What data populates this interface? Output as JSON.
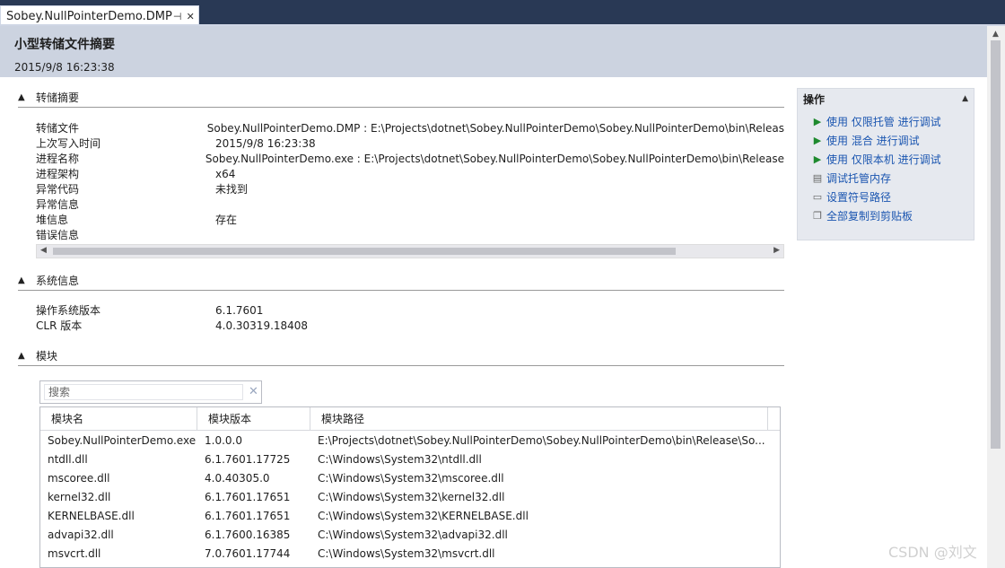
{
  "tab": {
    "title": "Sobey.NullPointerDemo.DMP",
    "pin_glyph": "⊣",
    "close_glyph": "✕"
  },
  "header": {
    "title": "小型转储文件摘要",
    "timestamp": "2015/9/8 16:23:38"
  },
  "sections": {
    "dump_summary": {
      "label": "转储摘要",
      "rows": [
        {
          "key": "转储文件",
          "value": "Sobey.NullPointerDemo.DMP : E:\\Projects\\dotnet\\Sobey.NullPointerDemo\\Sobey.NullPointerDemo\\bin\\Releas"
        },
        {
          "key": "上次写入时间",
          "value": "2015/9/8 16:23:38"
        },
        {
          "key": "进程名称",
          "value": "Sobey.NullPointerDemo.exe : E:\\Projects\\dotnet\\Sobey.NullPointerDemo\\Sobey.NullPointerDemo\\bin\\Release"
        },
        {
          "key": "进程架构",
          "value": "x64"
        },
        {
          "key": "异常代码",
          "value": "未找到"
        },
        {
          "key": "异常信息",
          "value": ""
        },
        {
          "key": "堆信息",
          "value": "存在"
        },
        {
          "key": "错误信息",
          "value": ""
        }
      ]
    },
    "system_info": {
      "label": "系统信息",
      "rows": [
        {
          "key": "操作系统版本",
          "value": "6.1.7601"
        },
        {
          "key": "CLR 版本",
          "value": "4.0.30319.18408"
        }
      ]
    },
    "modules": {
      "label": "模块",
      "search_placeholder": "搜索",
      "columns": [
        "模块名",
        "模块版本",
        "模块路径"
      ],
      "rows": [
        {
          "name": "Sobey.NullPointerDemo.exe",
          "version": "1.0.0.0",
          "path": "E:\\Projects\\dotnet\\Sobey.NullPointerDemo\\Sobey.NullPointerDemo\\bin\\Release\\So..."
        },
        {
          "name": "ntdll.dll",
          "version": "6.1.7601.17725",
          "path": "C:\\Windows\\System32\\ntdll.dll"
        },
        {
          "name": "mscoree.dll",
          "version": "4.0.40305.0",
          "path": "C:\\Windows\\System32\\mscoree.dll"
        },
        {
          "name": "kernel32.dll",
          "version": "6.1.7601.17651",
          "path": "C:\\Windows\\System32\\kernel32.dll"
        },
        {
          "name": "KERNELBASE.dll",
          "version": "6.1.7601.17651",
          "path": "C:\\Windows\\System32\\KERNELBASE.dll"
        },
        {
          "name": "advapi32.dll",
          "version": "6.1.7600.16385",
          "path": "C:\\Windows\\System32\\advapi32.dll"
        },
        {
          "name": "msvcrt.dll",
          "version": "7.0.7601.17744",
          "path": "C:\\Windows\\System32\\msvcrt.dll"
        }
      ]
    }
  },
  "actions": {
    "title": "操作",
    "items": [
      {
        "label": "使用 仅限托管 进行调试",
        "icon": "play-icon"
      },
      {
        "label": "使用 混合 进行调试",
        "icon": "play-icon"
      },
      {
        "label": "使用 仅限本机 进行调试",
        "icon": "play-icon"
      },
      {
        "label": "调试托管内存",
        "icon": "memory-icon"
      },
      {
        "label": "设置符号路径",
        "icon": "folder-icon"
      },
      {
        "label": "全部复制到剪贴板",
        "icon": "copy-icon"
      }
    ]
  },
  "watermark": "CSDN @刘文",
  "colors": {
    "tab_strip": "#293955",
    "header_band": "#ccd3e0",
    "link": "#1a55b0",
    "play": "#1e8a2e"
  }
}
